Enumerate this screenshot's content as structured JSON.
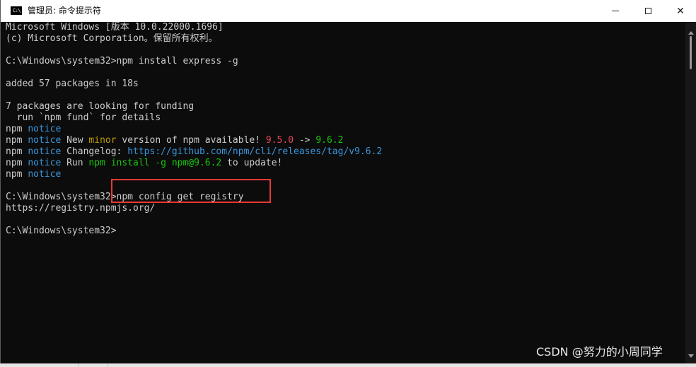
{
  "window": {
    "title": "管理员: 命令提示符",
    "icon_text": "C:\\",
    "minimize_glyph": "—",
    "maximize_glyph": "☐",
    "close_glyph": "✕"
  },
  "console": {
    "lines": [
      [
        {
          "t": "Microsoft Windows [版本 10.0.22000.1696]",
          "c": ""
        }
      ],
      [
        {
          "t": "(c) Microsoft Corporation。保留所有权利。",
          "c": ""
        }
      ],
      [
        {
          "t": "",
          "c": ""
        }
      ],
      [
        {
          "t": "C:\\Windows\\system32>npm install express -g",
          "c": ""
        }
      ],
      [
        {
          "t": "",
          "c": ""
        }
      ],
      [
        {
          "t": "added 57 packages in 18s",
          "c": ""
        }
      ],
      [
        {
          "t": "",
          "c": ""
        }
      ],
      [
        {
          "t": "7 packages are looking for funding",
          "c": ""
        }
      ],
      [
        {
          "t": "  run `npm fund` for details",
          "c": ""
        }
      ],
      [
        {
          "t": "npm ",
          "c": ""
        },
        {
          "t": "notice",
          "c": "cyan"
        }
      ],
      [
        {
          "t": "npm ",
          "c": ""
        },
        {
          "t": "notice",
          "c": "cyan"
        },
        {
          "t": " New ",
          "c": ""
        },
        {
          "t": "minor",
          "c": "yellow"
        },
        {
          "t": " version of npm available! ",
          "c": ""
        },
        {
          "t": "9.5.0",
          "c": "red"
        },
        {
          "t": " -> ",
          "c": ""
        },
        {
          "t": "9.6.2",
          "c": "green"
        }
      ],
      [
        {
          "t": "npm ",
          "c": ""
        },
        {
          "t": "notice",
          "c": "cyan"
        },
        {
          "t": " Changelog: ",
          "c": ""
        },
        {
          "t": "https://github.com/npm/cli/releases/tag/v9.6.2",
          "c": "cyan"
        }
      ],
      [
        {
          "t": "npm ",
          "c": ""
        },
        {
          "t": "notice",
          "c": "cyan"
        },
        {
          "t": " Run ",
          "c": ""
        },
        {
          "t": "npm install -g npm@9.6.2",
          "c": "green"
        },
        {
          "t": " to update!",
          "c": ""
        }
      ],
      [
        {
          "t": "npm ",
          "c": ""
        },
        {
          "t": "notice",
          "c": "cyan"
        }
      ],
      [
        {
          "t": "",
          "c": ""
        }
      ],
      [
        {
          "t": "C:\\Windows\\system32>npm config get registry",
          "c": ""
        }
      ],
      [
        {
          "t": "https://registry.npmjs.org/",
          "c": ""
        }
      ],
      [
        {
          "t": "",
          "c": ""
        }
      ],
      [
        {
          "t": "C:\\Windows\\system32>",
          "c": ""
        }
      ]
    ]
  },
  "colors": {
    "background": "#0c0c0c",
    "foreground": "#cccccc",
    "cyan": "#3a96dd",
    "yellow": "#c19c00",
    "red": "#e74856",
    "green": "#16c60c",
    "highlight": "#e53935"
  },
  "watermark": {
    "text": "CSDN @努力的小周同学"
  }
}
